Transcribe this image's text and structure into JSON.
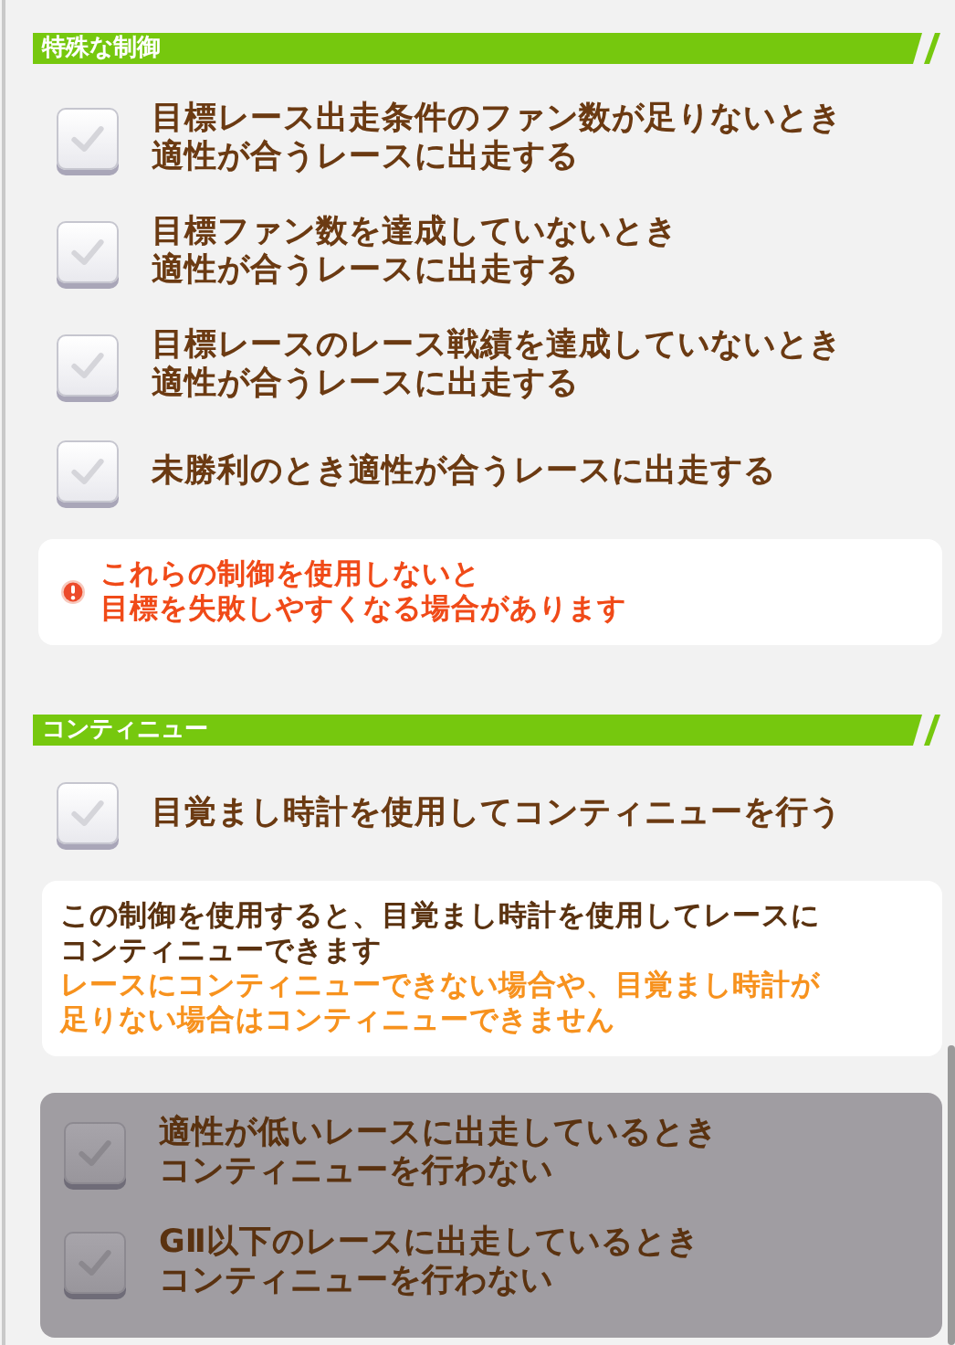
{
  "sections": [
    {
      "title": "特殊な制御",
      "items": [
        {
          "kind": "option",
          "lines": [
            "目標レース出走条件のファン数が足りないとき",
            "適性が合うレースに出走する"
          ],
          "checked": false
        },
        {
          "kind": "option",
          "lines": [
            "目標ファン数を達成していないとき",
            "適性が合うレースに出走する"
          ],
          "checked": false
        },
        {
          "kind": "option",
          "lines": [
            "目標レースのレース戦績を達成していないとき",
            "適性が合うレースに出走する"
          ],
          "checked": false
        },
        {
          "kind": "option",
          "lines": [
            "未勝利のとき適性が合うレースに出走する"
          ],
          "checked": false
        },
        {
          "kind": "warning",
          "lines": [
            "これらの制御を使用しないと",
            "目標を失敗しやすくなる場合があります"
          ]
        }
      ]
    },
    {
      "title": "コンティニュー",
      "items": [
        {
          "kind": "option",
          "lines": [
            "目覚まし時計を使用してコンティニューを行う"
          ],
          "checked": false
        },
        {
          "kind": "info",
          "lines": [
            "この制御を使用すると、目覚まし時計を使用してレースに",
            "コンティニューできます"
          ],
          "caution": [
            "レースにコンティニューできない場合や、目覚まし時計が",
            "足りない場合はコンティニューできません"
          ]
        },
        {
          "kind": "group",
          "disabled": true,
          "options": [
            {
              "lines": [
                "適性が低いレースに出走しているとき",
                "コンティニューを行わない"
              ],
              "checked": false
            },
            {
              "lines": [
                "GⅡ以下のレースに出走しているとき",
                "コンティニューを行わない"
              ],
              "checked": false
            }
          ]
        }
      ]
    }
  ]
}
